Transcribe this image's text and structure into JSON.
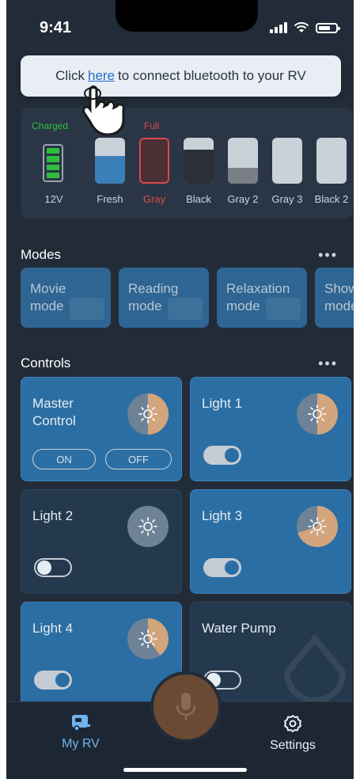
{
  "status_bar": {
    "time": "9:41"
  },
  "banner": {
    "before": "Click",
    "link": "here",
    "after": "to connect bluetooth to your RV"
  },
  "tanks": {
    "battery": {
      "status": "Charged",
      "label": "12V",
      "color": "#2fbf3a"
    },
    "items": [
      {
        "label": "Fresh",
        "level": 0.6,
        "fill_color": "#3a7fb8"
      },
      {
        "label": "Gray",
        "status": "Full",
        "level": 1.0,
        "fill_color": "#4a2f35",
        "alert_color": "#d84a4a"
      },
      {
        "label": "Black",
        "level": 0.75,
        "fill_color": "#2b3038"
      },
      {
        "label": "Gray 2",
        "level": 0.35,
        "fill_color": "#7a7f85"
      },
      {
        "label": "Gray 3",
        "level": 0.0,
        "fill_color": "#7a7f85"
      },
      {
        "label": "Black 2",
        "level": 0.0,
        "fill_color": "#7a7f85"
      }
    ]
  },
  "modes": {
    "title": "Modes",
    "more": "•••",
    "items": [
      {
        "line1": "Movie",
        "line2": "mode"
      },
      {
        "line1": "Reading",
        "line2": "mode"
      },
      {
        "line1": "Relaxation",
        "line2": "mode"
      },
      {
        "line1": "Show",
        "line2": "mode"
      }
    ]
  },
  "controls": {
    "title": "Controls",
    "more": "•••",
    "master": {
      "line1": "Master",
      "line2": "Control",
      "on_label": "ON",
      "off_label": "OFF",
      "level": 0.5
    },
    "items": [
      {
        "label": "Light 1",
        "on": true,
        "level": 0.5
      },
      {
        "label": "Light 2",
        "on": false,
        "level": 0.0
      },
      {
        "label": "Light 3",
        "on": true,
        "level": 0.7
      },
      {
        "label": "Light 4",
        "on": true,
        "level": 0.4
      },
      {
        "label": "Water Pump",
        "on": false,
        "level": 0.0
      }
    ]
  },
  "tabbar": {
    "my_rv": "My RV",
    "settings": "Settings"
  },
  "colors": {
    "accent_on": "#2b6ea3",
    "dial_fill": "#d3a57c",
    "dial_base": "#6d8296",
    "alert": "#d84a4a",
    "charged": "#2fbf3a"
  }
}
